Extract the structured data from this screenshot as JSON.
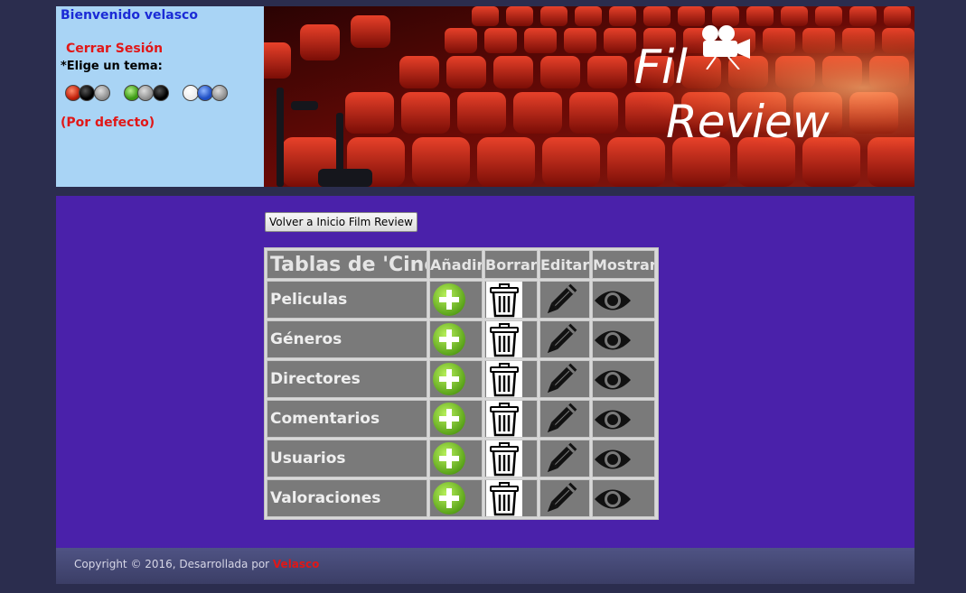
{
  "header": {
    "welcome": "Bienvenido velasco",
    "logout": "Cerrar Sesión",
    "theme_label": "*Elige un tema:",
    "default_theme": "(Por defecto)"
  },
  "banner": {
    "logo_line1": "Fil",
    "logo_line2": "Review"
  },
  "main": {
    "back_button": "Volver a Inicio Film Review",
    "table": {
      "headers": [
        "Tablas de 'Cine'",
        "Añadir",
        "Borrar",
        "Editar",
        "Mostrar"
      ],
      "rows": [
        "Peliculas",
        "Géneros",
        "Directores",
        "Comentarios",
        "Usuarios",
        "Valoraciones"
      ]
    }
  },
  "footer": {
    "copyright": "Copyright © 2016, Desarrollada por",
    "author": "Velasco"
  }
}
